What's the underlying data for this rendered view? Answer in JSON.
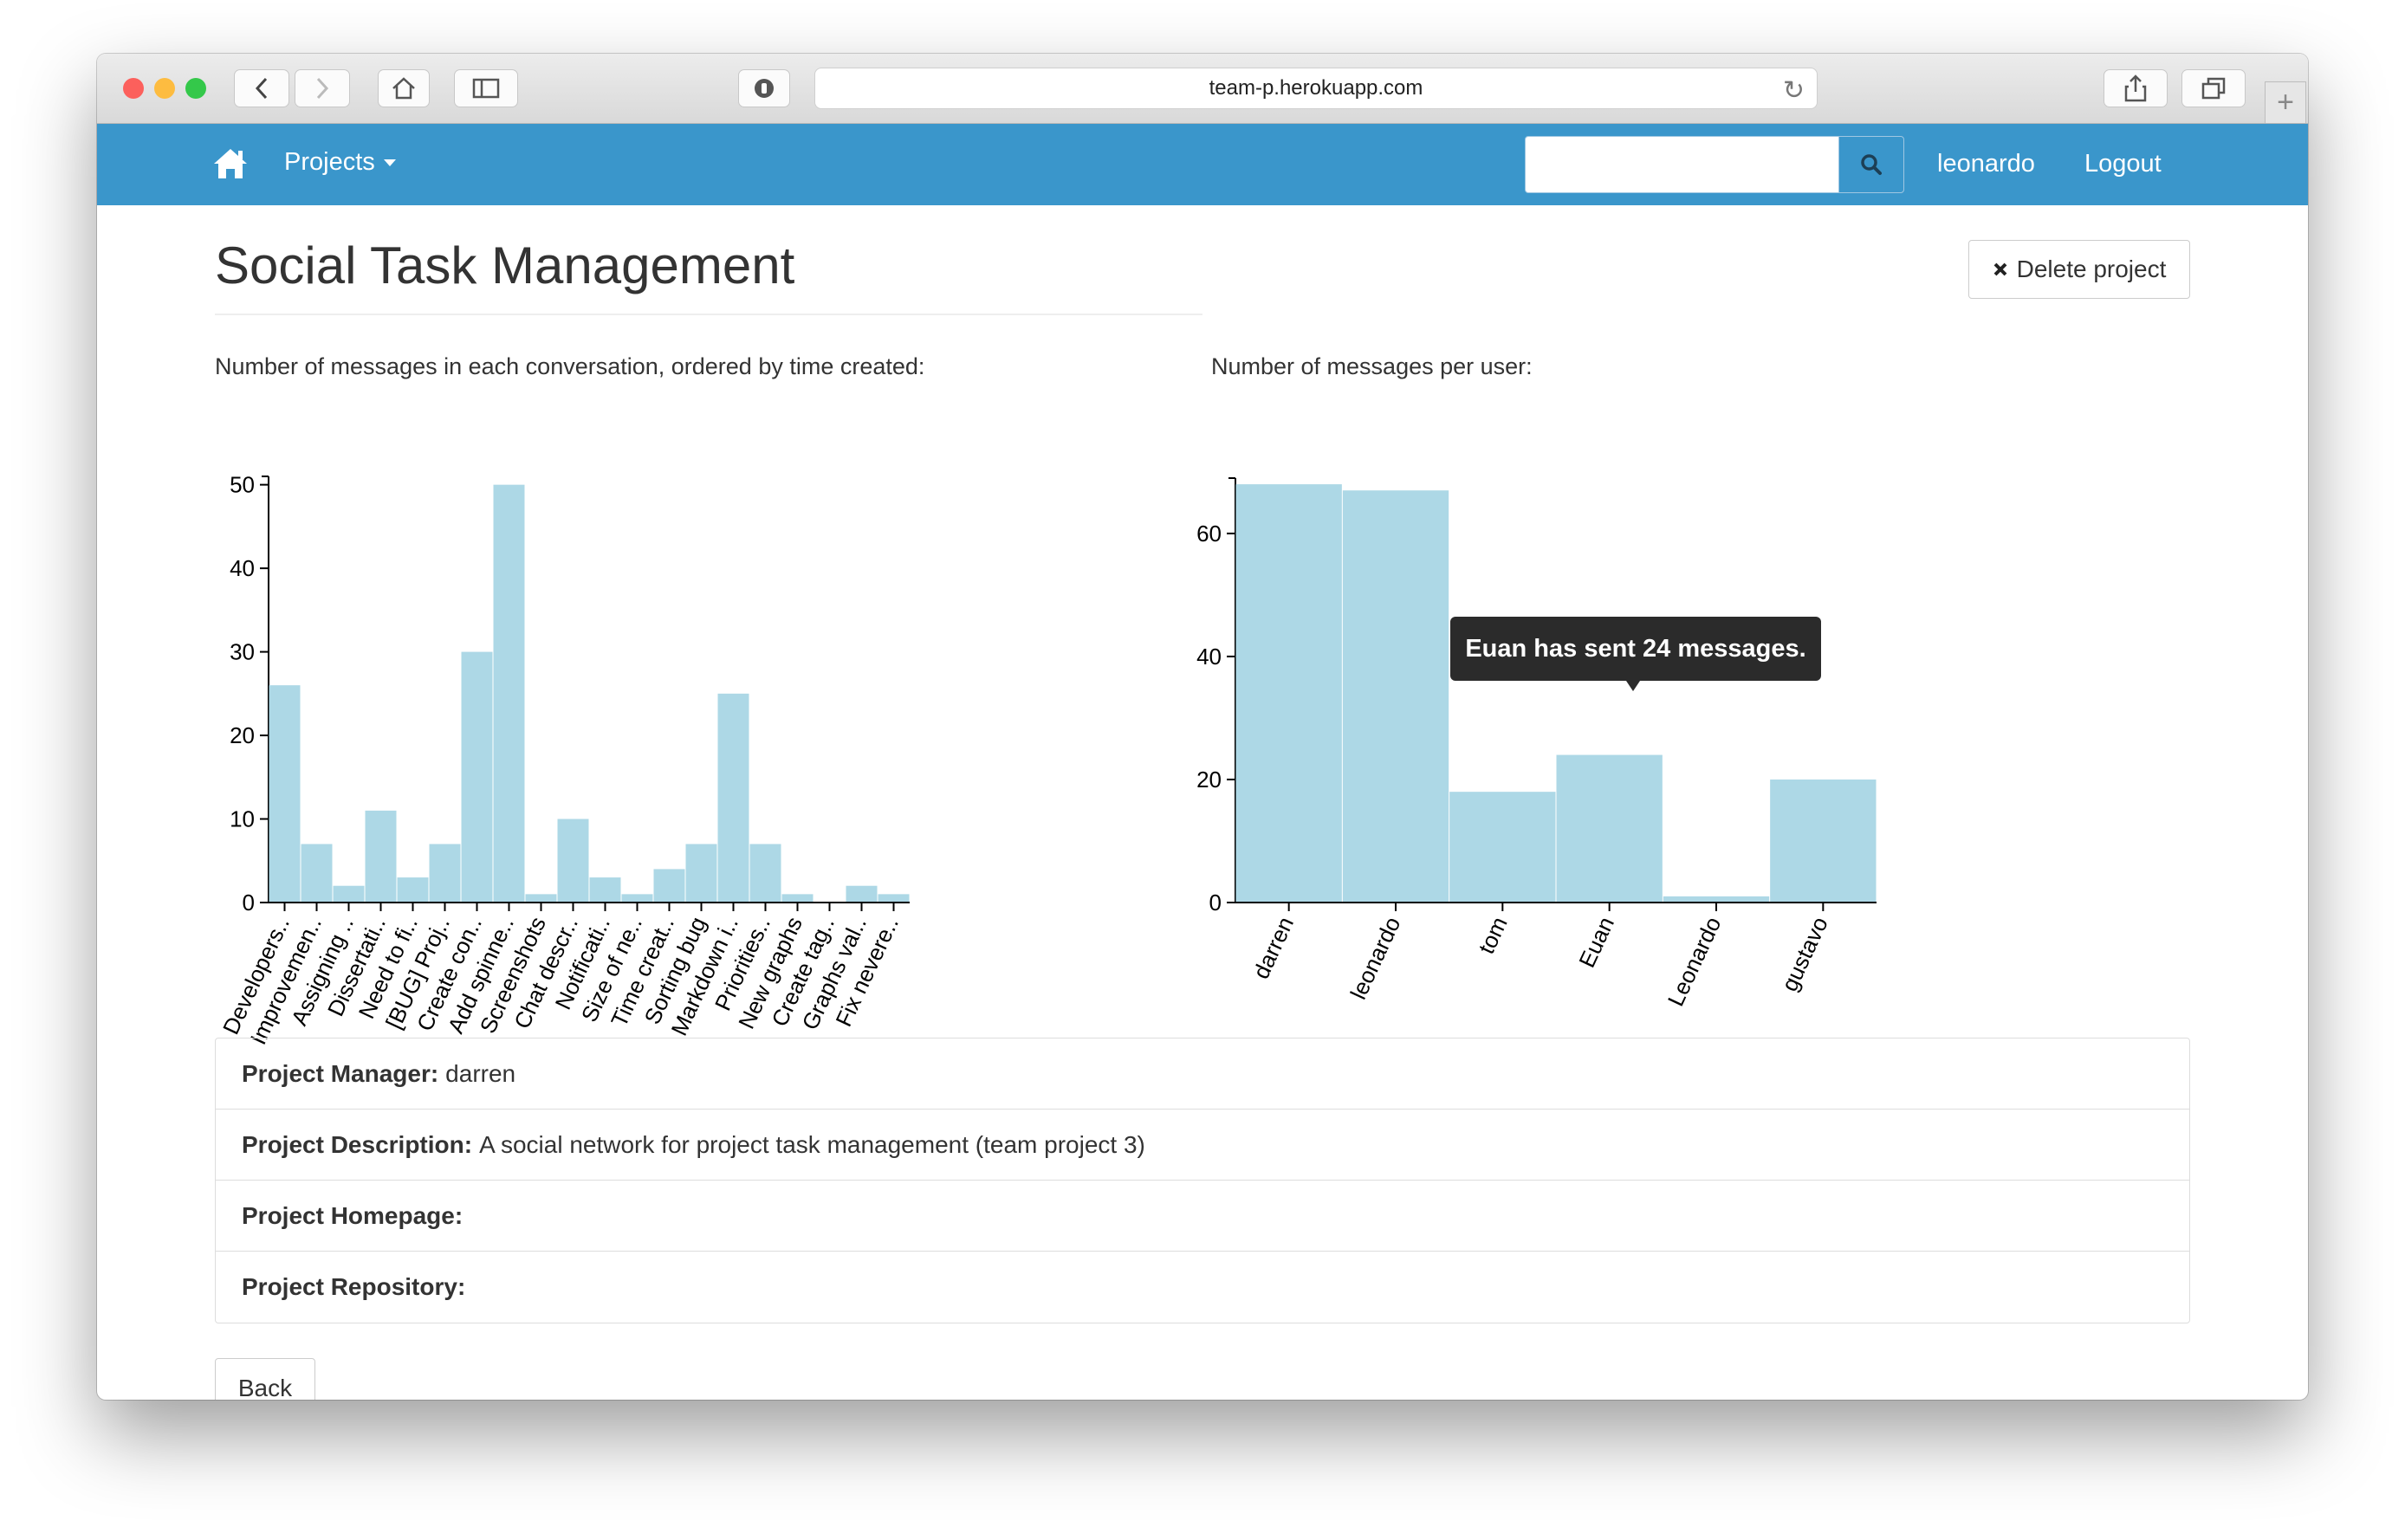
{
  "browser": {
    "url": "team-p.herokuapp.com",
    "traffic_lights": [
      "#fc605c",
      "#fdbc40",
      "#34c84a"
    ]
  },
  "navbar": {
    "brand_icon": "home-icon",
    "projects_label": "Projects",
    "search_placeholder": "",
    "search_icon": "search-icon",
    "user_label": "leonardo",
    "logout_label": "Logout",
    "color": "#3a96cb"
  },
  "page": {
    "title": "Social Task Management",
    "delete_label": "Delete project",
    "back_label": "Back"
  },
  "charts": {
    "left_caption": "Number of messages in each conversation, ordered by time created:",
    "right_caption": "Number of messages per user:",
    "tooltip": "Euan has sent 24 messages."
  },
  "chart_data": [
    {
      "type": "bar",
      "title": "Number of messages in each conversation, ordered by time created:",
      "categories": [
        "Developers..",
        "Improvemen..",
        "Assigning ..",
        "Dissertati..",
        "Need to fi..",
        "[BUG] Proj..",
        "Create con..",
        "Add spinne..",
        "Screenshots",
        "Chat descr..",
        "Notificati..",
        "Size of ne..",
        "Time creat..",
        "Sorting bug",
        "Markdown i..",
        "Priorities..",
        "New graphs",
        "Create tag..",
        "Graphs val..",
        "Fix nevere.."
      ],
      "values": [
        26,
        7,
        2,
        11,
        3,
        7,
        30,
        50,
        1,
        10,
        3,
        1,
        4,
        7,
        25,
        7,
        1,
        0,
        2,
        1
      ],
      "ylim": [
        0,
        51
      ],
      "yticks": [
        0,
        10,
        20,
        30,
        40,
        50
      ],
      "color": "#add8e6"
    },
    {
      "type": "bar",
      "title": "Number of messages per user:",
      "categories": [
        "darren",
        "leonardo",
        "tom",
        "Euan",
        "Leonardo",
        "gustavo"
      ],
      "values": [
        68,
        67,
        18,
        24,
        1,
        20
      ],
      "ylim": [
        0,
        69
      ],
      "yticks": [
        0,
        20,
        40,
        60
      ],
      "color": "#add8e6"
    }
  ],
  "project_info": [
    {
      "label": "Project Manager:",
      "value": "darren"
    },
    {
      "label": "Project Description:",
      "value": "A social network for project task management (team project 3)"
    },
    {
      "label": "Project Homepage:",
      "value": ""
    },
    {
      "label": "Project Repository:",
      "value": ""
    }
  ]
}
